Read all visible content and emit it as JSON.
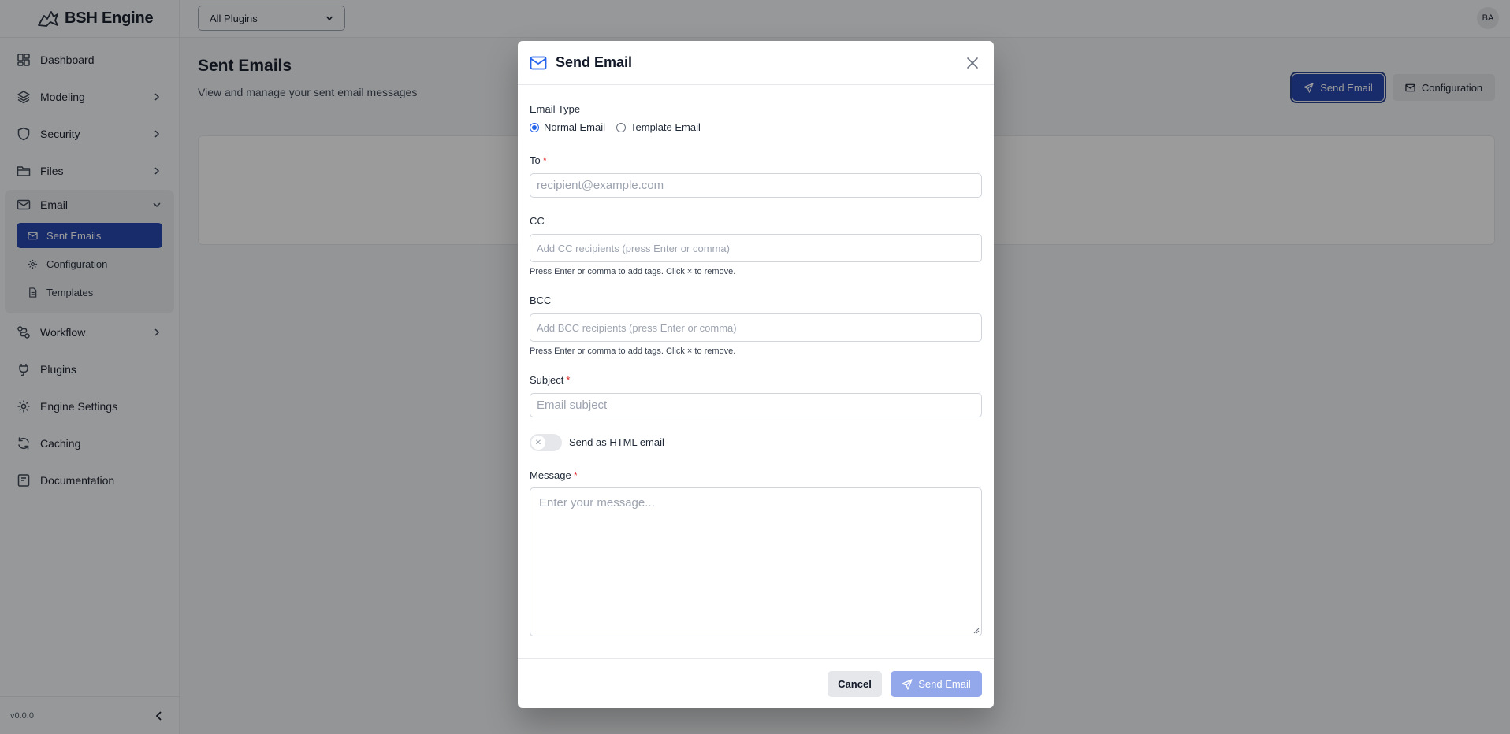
{
  "app": {
    "brand_name": "BSH Engine",
    "version": "v0.0.0",
    "accent_color": "#1e40af"
  },
  "sidebar": {
    "items": [
      {
        "label": "Dashboard",
        "icon": "dashboard-icon"
      },
      {
        "label": "Modeling",
        "icon": "layers-icon"
      },
      {
        "label": "Security",
        "icon": "shield-icon"
      },
      {
        "label": "Files",
        "icon": "folder-icon"
      },
      {
        "label": "Email",
        "icon": "mail-icon"
      },
      {
        "label": "Workflow",
        "icon": "workflow-icon"
      },
      {
        "label": "Plugins",
        "icon": "plug-icon"
      },
      {
        "label": "Engine Settings",
        "icon": "gear-icon"
      },
      {
        "label": "Caching",
        "icon": "refresh-icon"
      },
      {
        "label": "Documentation",
        "icon": "book-icon"
      }
    ],
    "email_sub": [
      {
        "label": "Sent Emails",
        "icon": "mail-icon",
        "active": true
      },
      {
        "label": "Configuration",
        "icon": "gear-icon"
      },
      {
        "label": "Templates",
        "icon": "file-text-icon"
      }
    ]
  },
  "topbar": {
    "plugin_select": "All Plugins",
    "avatar_initials": "BA"
  },
  "page": {
    "title": "Sent Emails",
    "subtitle": "View and manage your sent email messages",
    "send_button": "Send Email",
    "config_button": "Configuration"
  },
  "modal": {
    "title": "Send Email",
    "email_type_label": "Email Type",
    "type_options": [
      "Normal Email",
      "Template Email"
    ],
    "selected_type": "Normal Email",
    "to_label": "To",
    "to_placeholder": "recipient@example.com",
    "cc_label": "CC",
    "cc_placeholder": "Add CC recipients (press Enter or comma)",
    "cc_help": "Press Enter or comma to add tags. Click × to remove.",
    "bcc_label": "BCC",
    "bcc_placeholder": "Add BCC recipients (press Enter or comma)",
    "bcc_help": "Press Enter or comma to add tags. Click × to remove.",
    "subject_label": "Subject",
    "subject_placeholder": "Email subject",
    "html_toggle_label": "Send as HTML email",
    "html_toggle_on": false,
    "message_label": "Message",
    "message_placeholder": "Enter your message...",
    "required_mark": "*",
    "cancel_button": "Cancel",
    "send_button": "Send Email"
  }
}
